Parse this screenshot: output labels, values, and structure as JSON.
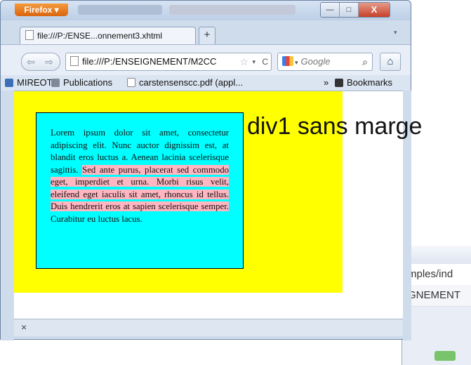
{
  "background_window": {
    "address_fragment": "mples/ind",
    "path_fragment": "GNEMENT"
  },
  "browser": {
    "app_button": "Firefox ▾",
    "tab_title": "file:///P:/ENSE...onnement3.xhtml",
    "new_tab": "+",
    "url": "file:///P:/ENSEIGNEMENT/M2CC",
    "search_placeholder": "Google",
    "window_controls": {
      "minimize": "—",
      "maximize": "□",
      "close": "X"
    },
    "bookmarks": [
      {
        "label": "MIREOT",
        "icon": "mireot-icon",
        "color": "#3b6fb6"
      },
      {
        "label": "Publications",
        "icon": "publications-icon",
        "color": "#7f8a99"
      },
      {
        "label": "carstensenscc.pdf (appl...",
        "icon": "page-icon",
        "color": "#ffffff"
      }
    ],
    "bookmarks_overflow": "»",
    "bookmarks_menu": "Bookmarks",
    "status_close": "×"
  },
  "page": {
    "text_before": "Lorem ipsum dolor sit amet, consectetur adipiscing elit. Nunc auctor dignissim est, at blandit eros luctus a. Aenean lacinia scelerisque sagittis. ",
    "text_highlighted": "Sed ante purus, placerat sed commodo eget, imperdiet et urna. Morbi risus velit, eleifend eget iaculis sit amet, rhoncus id tellus. Duis hendrerit eros at sapien scelerisque semper.",
    "text_after": " Curabitur eu luctus lacus.",
    "outer_color": "#ffff00",
    "box_color": "#00ffff",
    "highlight_color": "#ffb6c1"
  },
  "annotation": "div1 sans marge"
}
